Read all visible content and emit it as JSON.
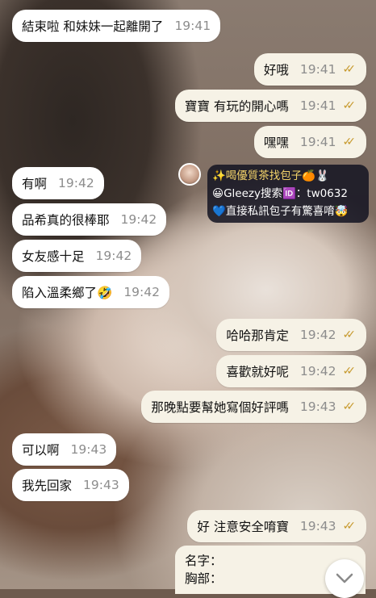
{
  "messages": [
    {
      "dir": "in",
      "text": "結束啦 和妹妹一起離開了",
      "time": "19:41"
    },
    {
      "dir": "out",
      "text": "好哦",
      "time": "19:41"
    },
    {
      "dir": "out",
      "text": "寶寶 有玩的開心嗎",
      "time": "19:41"
    },
    {
      "dir": "out",
      "text": "嘿嘿",
      "time": "19:41"
    },
    {
      "dir": "in",
      "text": "有啊",
      "time": "19:42"
    },
    {
      "dir": "in",
      "text": "品希真的很棒耶",
      "time": "19:42"
    },
    {
      "dir": "in",
      "text": "女友感十足",
      "time": "19:42"
    },
    {
      "dir": "in",
      "text": "陷入溫柔鄉了🤣",
      "time": "19:42"
    },
    {
      "dir": "out",
      "text": "哈哈那肯定",
      "time": "19:42"
    },
    {
      "dir": "out",
      "text": "喜歡就好呢",
      "time": "19:42"
    },
    {
      "dir": "out",
      "text": "那晚點要幫她寫個好評嗎",
      "time": "19:43"
    },
    {
      "dir": "in",
      "text": "可以啊",
      "time": "19:43"
    },
    {
      "dir": "in",
      "text": "我先回家",
      "time": "19:43"
    },
    {
      "dir": "out",
      "text": "好 注意安全唷寶",
      "time": "19:43"
    }
  ],
  "overlay": {
    "line1": "✨喝優質茶找包子🍊🐰",
    "line2": "😀Gleezy搜索🆔：tw0632",
    "line3": "💙直接私訊包子有驚喜唷🤯"
  },
  "info": {
    "line1": "名字：",
    "line2": "胸部："
  },
  "icons": {
    "read_ticks": "double-check-icon",
    "scroll_down": "chevron-down-icon"
  },
  "colors": {
    "incoming_bubble": "#ffffff",
    "outgoing_bubble": "#f6f2e6",
    "read_tick": "#c79a2e"
  }
}
